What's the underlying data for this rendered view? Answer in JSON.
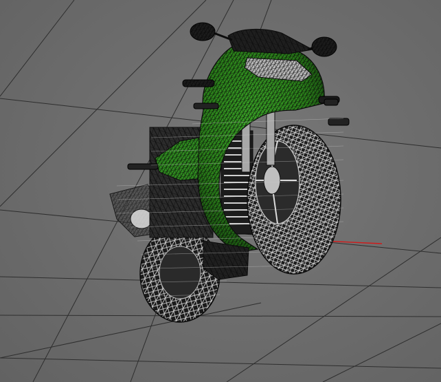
{
  "viewport": {
    "background_color": "#6b6b6b",
    "grid_color": "#2e2e2e",
    "x_axis_color": "#d11a1a",
    "model_name": "motorcycle-wireframe",
    "model_primary_color": "#2e8b1e",
    "wireframe_color": "#111111",
    "shading_mode": "wireframe-on-shaded"
  }
}
